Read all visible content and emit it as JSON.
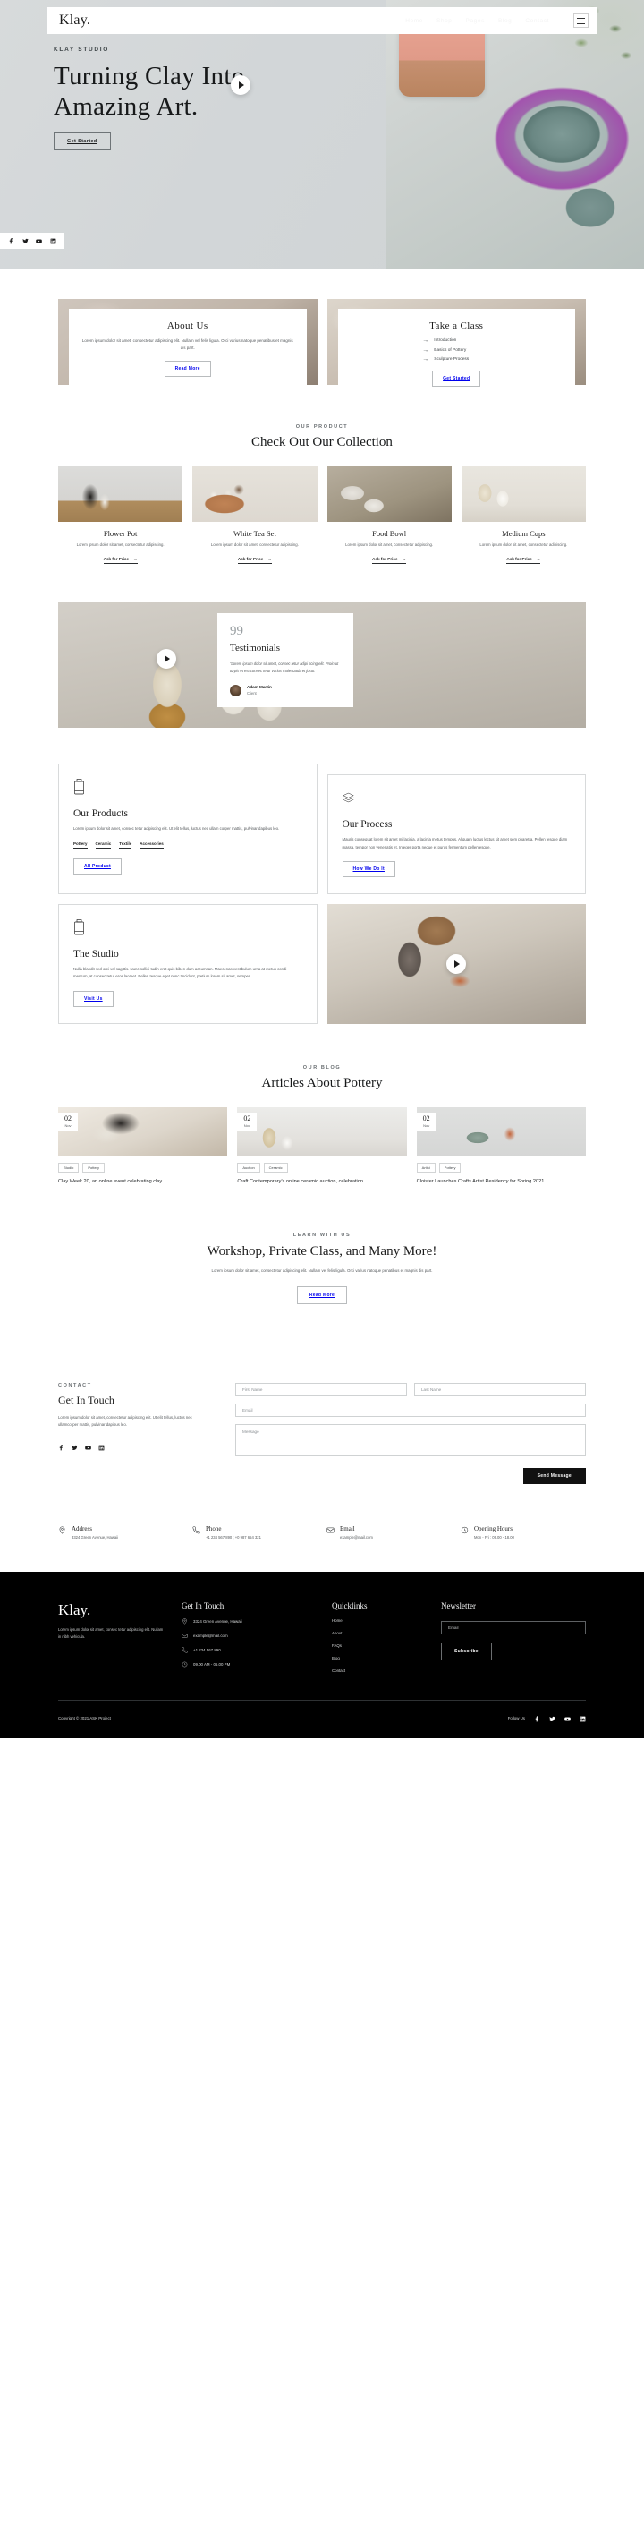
{
  "brand": "Klay.",
  "nav": {
    "links": [
      "Home",
      "Shop",
      "Pages",
      "Blog",
      "Contact"
    ],
    "menu_icon": "hamburger-menu-icon"
  },
  "hero": {
    "eyebrow": "KLAY STUDIO",
    "title_line1": "Turning Clay Into",
    "title_line2": "Amazing Art.",
    "cta": "Get Started",
    "play": "play-icon",
    "socials": [
      "facebook-icon",
      "twitter-icon",
      "youtube-icon",
      "linkedin-icon"
    ]
  },
  "about_card": {
    "title": "About Us",
    "body": "Lorem ipsum dolor sit amet, consectetur adipiscing elit. Nullam vel felis ligula. Orci varius natoque penatibus et magnis dis part.",
    "button": "Read More"
  },
  "class_card": {
    "title": "Take a Class",
    "items": [
      "Introduction",
      "Basics of Pottery",
      "Sculpture Process"
    ],
    "button": "Get Started"
  },
  "products": {
    "label": "OUR PRODUCT",
    "title": "Check Out Our Collection",
    "cta": "Ask for Price",
    "items": [
      {
        "name": "Flower Pot",
        "desc": "Lorem ipsum dolor sit amet, consectetur adipiscing."
      },
      {
        "name": "White Tea Set",
        "desc": "Lorem ipsum dolor sit amet, consectetur adipiscing."
      },
      {
        "name": "Food Bowl",
        "desc": "Lorem ipsum dolor sit amet, consectetur adipiscing."
      },
      {
        "name": "Medium Cups",
        "desc": "Lorem ipsum dolor sit amet, consectetur adipiscing."
      }
    ]
  },
  "testimonials": {
    "quote_mark": "99",
    "title": "Testimonials",
    "quote": "“Lorem ipsum dolor sit amet, consec tetur adipi scing elit. Proin ut turpis et est consec tetur varius malesuada et justo.”",
    "author": "Adam Martin",
    "role": "Client",
    "play": "play-icon"
  },
  "features": {
    "products": {
      "icon": "jar-icon",
      "title": "Our Products",
      "body": "Lorem ipsum dolor sit amet, consec tetur adipiscing elit. Ut elit tellus, luctus nec ullam corper mattis, pulvinar dapibus leo.",
      "tags": [
        "Pottery",
        "Ceramic",
        "Textile",
        "Accessories"
      ],
      "button": "All Product"
    },
    "process": {
      "icon": "layers-icon",
      "title": "Our Process",
      "body": "Mauris consequat lorem sit amet mi lacinia, a lacinia metus tempus. Aliquam luctus lectus sit amet sem pharetra. Pellen tesque diam massa, tempor non venenatis et. Integer porta neque et purus fermentum pellentesque.",
      "button": "How We Do It"
    },
    "studio": {
      "icon": "jar-icon",
      "title": "The Studio",
      "body": "Nulla blandit sed orci vel sagittis. Nunc sollici tudin erat quis biben dum accumsan. Maecenas vestibulum urna at metus condi mentum, at consec tetur eros laoreet. Pellen tesque eget nunc tincidunt, pretium lorem sit amet, semper.",
      "button": "Visit Us"
    },
    "studio_play": "play-icon"
  },
  "blog": {
    "label": "OUR BLOG",
    "title": "Articles About Pottery",
    "posts": [
      {
        "day": "02",
        "month": "Nov",
        "tags": [
          "Studio",
          "Pottery"
        ],
        "title": "Clay Week 20, an online event celebrating clay"
      },
      {
        "day": "02",
        "month": "Nov",
        "tags": [
          "Auction",
          "Ceramic"
        ],
        "title": "Craft Contemporary's online ceramic auction, celebration"
      },
      {
        "day": "02",
        "month": "Nov",
        "tags": [
          "Artist",
          "Pottery"
        ],
        "title": "Cloister Launches Crafts Artist Residency for Spring 2021"
      }
    ]
  },
  "cta": {
    "label": "LEARN WITH US",
    "title": "Workshop, Private Class, and Many More!",
    "body": "Lorem ipsum dolor sit amet, consectetur adipiscing elit. Nullam vel felis ligula. Orci varius natoque penatibus et magnis dis part.",
    "button": "Read More"
  },
  "contact": {
    "label": "CONTACT",
    "title": "Get In Touch",
    "body": "Lorem ipsum dolor sit amet, consectetur adipiscing elit. Ut elit tellus, luctus nec ullamcorper mattis, pulvinar dapibus leo.",
    "socials": [
      "facebook-icon",
      "twitter-icon",
      "youtube-icon",
      "linkedin-icon"
    ],
    "form": {
      "first_name": "First Name",
      "last_name": "Last Name",
      "email": "Email",
      "message": "Message",
      "submit": "Send Message"
    }
  },
  "info": [
    {
      "icon": "map-pin-icon",
      "title": "Address",
      "value": "3324 Green Avenue, Hawaii"
    },
    {
      "icon": "phone-icon",
      "title": "Phone",
      "value": "+1 234 567 890 ; +0 987 654 321"
    },
    {
      "icon": "mail-icon",
      "title": "Email",
      "value": "example@mail.com"
    },
    {
      "icon": "clock-icon",
      "title": "Opening Hours",
      "value": "Mon - Fri : 09.00 - 18.00"
    }
  ],
  "footer": {
    "brand": "Klay.",
    "desc": "Lorem ipsum dolor sit amet, consec tetur adipiscing elit. Nullam in nibh vehicula.",
    "touch": {
      "title": "Get In Touch",
      "items": [
        {
          "icon": "map-pin-icon",
          "value": "3324 Green Avenue, Hawaii"
        },
        {
          "icon": "mail-icon",
          "value": "example@mail.com"
        },
        {
          "icon": "phone-icon",
          "value": "+1 234 567 890"
        },
        {
          "icon": "clock-icon",
          "value": "09.00 AM - 06.00 PM"
        }
      ]
    },
    "quicklinks": {
      "title": "Quicklinks",
      "items": [
        "Home",
        "About",
        "FAQs",
        "Blog",
        "Contact"
      ]
    },
    "newsletter": {
      "title": "Newsletter",
      "placeholder": "Email",
      "button": "Subscribe"
    },
    "copyright": "Copyright © 2021 ASK Project",
    "follow_label": "Follow Us",
    "socials": [
      "facebook-icon",
      "twitter-icon",
      "youtube-icon",
      "linkedin-icon"
    ]
  },
  "colors": {
    "dark": "#000000",
    "paper": "#ffffff",
    "muted": "#55595c"
  }
}
